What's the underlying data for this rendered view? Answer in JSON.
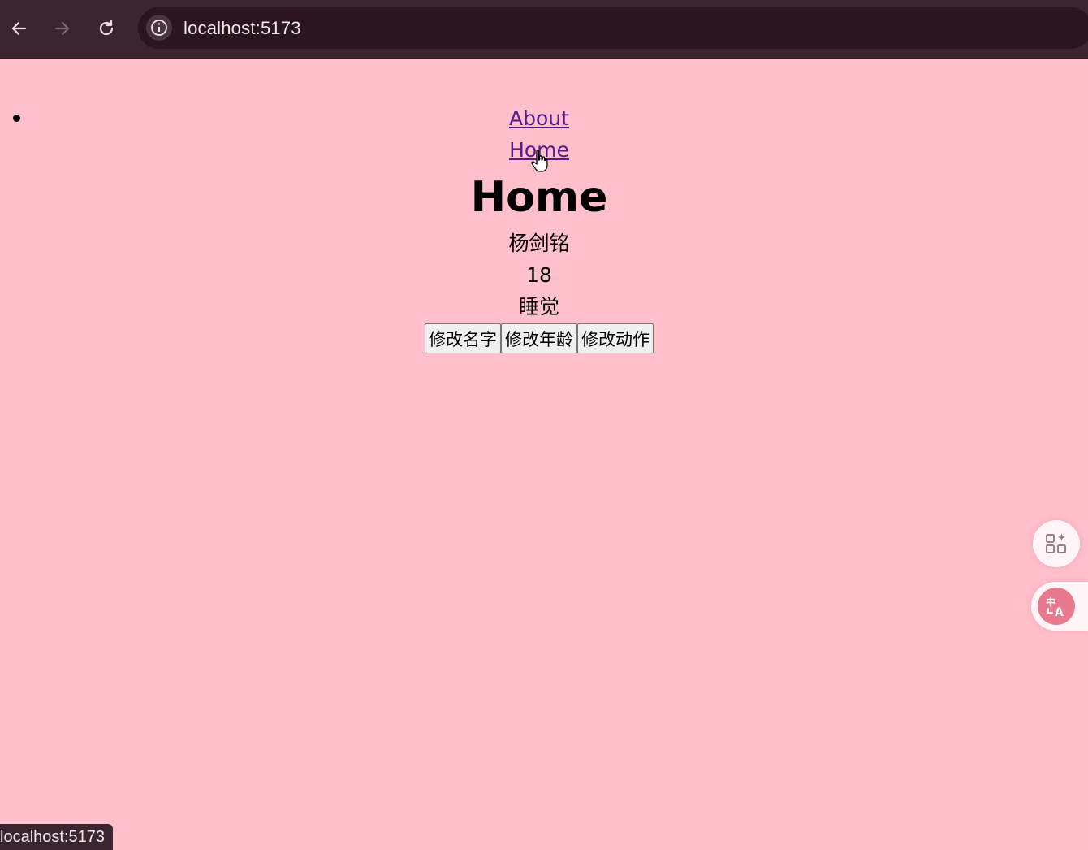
{
  "browser": {
    "url": "localhost:5173",
    "back_icon": "arrow-left-icon",
    "forward_icon": "arrow-right-icon",
    "reload_icon": "reload-icon",
    "site_info_icon": "info-icon"
  },
  "page": {
    "background": "#ffc0cb",
    "nav_links": [
      "About",
      "Home"
    ],
    "title": "Home",
    "person": {
      "name": "杨剑铭",
      "age": "18",
      "action": "睡觉"
    },
    "buttons": {
      "change_name": "修改名字",
      "change_age": "修改年龄",
      "change_action": "修改动作"
    }
  },
  "status_bar": {
    "url": "localhost:5173"
  },
  "floating": {
    "apps_icon": "apps-sparkle-icon",
    "translate_icon": "translate-icon"
  }
}
